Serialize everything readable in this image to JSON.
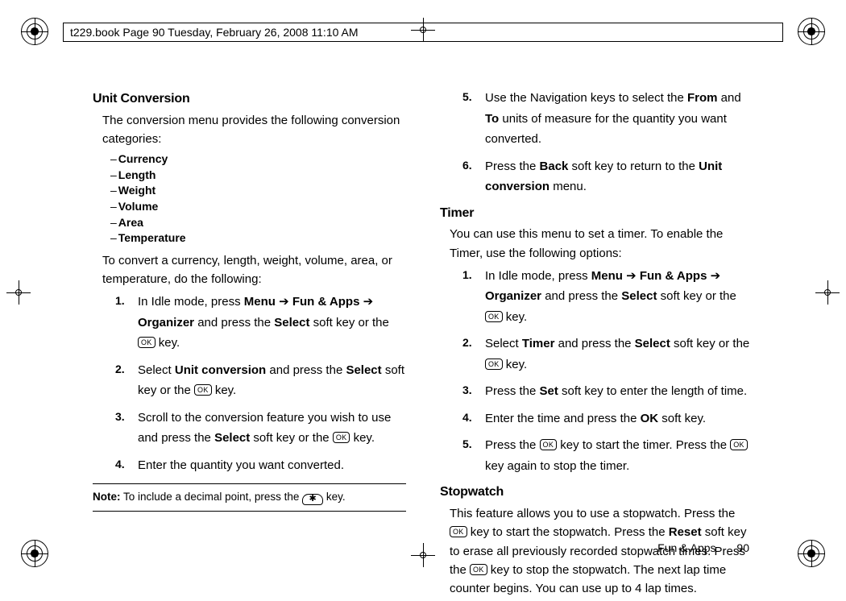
{
  "header": {
    "text": "t229.book  Page 90  Tuesday, February 26, 2008  11:10 AM"
  },
  "keys": {
    "ok": "OK",
    "star": "✱"
  },
  "footer": {
    "section": "Fun & Apps",
    "page": "90"
  },
  "sec1": {
    "title": "Unit Conversion",
    "intro": "The conversion menu provides the following conversion categories:",
    "bullets": [
      "Currency",
      "Length",
      "Weight",
      "Volume",
      "Area",
      "Temperature"
    ],
    "lead2": "To convert a currency, length, weight, volume, area, or temperature, do the following:",
    "steps": {
      "s1a": "In Idle mode, press ",
      "s1_menu": "Menu",
      "s1_arrow": " ➔ ",
      "s1_fun": "Fun & Apps",
      "s1_org": "Organizer",
      "s1b": " and press the ",
      "s1_select": "Select",
      "s1c": " soft key or the ",
      "s1d": " key.",
      "s2a": "Select ",
      "s2_uc": "Unit conversion",
      "s2b": " and press the ",
      "s2_select": "Select",
      "s2c": " soft key or the ",
      "s2d": " key.",
      "s3a": "Scroll to the conversion feature you wish to use and press the ",
      "s3_select": "Select",
      "s3b": " soft key or the ",
      "s3c": " key.",
      "s4": "Enter the quantity you want converted.",
      "s5a": "Use the Navigation keys to select the ",
      "s5_from": "From",
      "s5b": " and ",
      "s5_to": "To",
      "s5c": " units of measure for the quantity you want converted.",
      "s6a": "Press the ",
      "s6_back": "Back",
      "s6b": " soft key to return to the ",
      "s6_uc": "Unit conversion",
      "s6c": " menu."
    },
    "note": {
      "label": "Note:",
      "text_a": " To include a decimal point, press the ",
      "text_b": " key."
    }
  },
  "sec2": {
    "title": "Timer",
    "intro": "You can use this menu to set a timer. To enable the Timer, use the following options:",
    "steps": {
      "s1a": "In Idle mode, press ",
      "s1_menu": "Menu",
      "s1_arrow": " ➔ ",
      "s1_fun": "Fun & Apps",
      "s1_org": "Organizer",
      "s1b": " and press the ",
      "s1_select": "Select",
      "s1c": " soft key or the ",
      "s1d": " key.",
      "s2a": "Select ",
      "s2_timer": "Timer",
      "s2b": " and press the ",
      "s2_select": "Select",
      "s2c": " soft key or the ",
      "s2d": " key.",
      "s3a": "Press the ",
      "s3_set": "Set",
      "s3b": " soft key to enter the length of time.",
      "s4a": "Enter the time and press the ",
      "s4_ok": "OK",
      "s4b": " soft key.",
      "s5a": "Press the ",
      "s5b": " key to start the timer. Press the ",
      "s5c": " key again to stop the timer."
    }
  },
  "sec3": {
    "title": "Stopwatch",
    "p_a": "This feature allows you to use a stopwatch. Press the ",
    "p_b": " key to start the stopwatch. Press the ",
    "p_reset": "Reset",
    "p_c": " soft key to erase all previously recorded stopwatch times. Press the ",
    "p_d": " key to stop the stopwatch. The next lap time counter begins. You can use up to 4 lap times."
  }
}
